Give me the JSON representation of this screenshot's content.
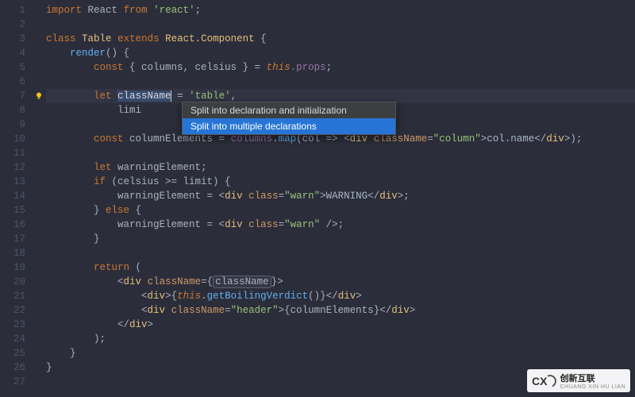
{
  "gutter": {
    "lines": [
      "1",
      "2",
      "3",
      "4",
      "5",
      "6",
      "7",
      "8",
      "9",
      "10",
      "11",
      "12",
      "13",
      "14",
      "15",
      "16",
      "17",
      "18",
      "19",
      "20",
      "21",
      "22",
      "23",
      "24",
      "25",
      "26",
      "27"
    ]
  },
  "code": {
    "l1": {
      "kw1": "import",
      "id": "React",
      "kw2": "from",
      "str": "'react'",
      "semi": ";"
    },
    "l3": {
      "kw": "class",
      "cls": "Table",
      "ext": "extends",
      "sup": "React.Component",
      "brace": " {"
    },
    "l4": {
      "fn": "render",
      "rest": "() {"
    },
    "l5": {
      "kw": "const",
      "rest": " { columns, celsius } = ",
      "this": "this",
      "prop": ".props",
      "semi": ";"
    },
    "l7": {
      "kw": "let",
      "name": "className",
      "op": " = ",
      "str": "'table'",
      "comma": ","
    },
    "l8": {
      "id": "limi"
    },
    "l10": {
      "kw": "const",
      "id": " columnElements = ",
      "obj": "columns",
      "dot": ".",
      "fn": "map",
      "open": "(",
      "param": "col",
      "arrow": " => ",
      "jsx_open": "<",
      "tag": "div",
      "sp": " ",
      "attr": "className",
      "eq": "=",
      "val": "\"column\"",
      "gt": ">",
      "expr": "col.name",
      "jsx_close": "</",
      "tag2": "div",
      "end": ">);"
    },
    "l12": {
      "kw": "let",
      "id": " warningElement;"
    },
    "l13": {
      "kw": "if",
      "cond": " (celsius >= limit) {"
    },
    "l14": {
      "lhs": "warningElement = ",
      "jsx_open": "<",
      "tag": "div",
      "sp": " ",
      "attr": "class",
      "eq": "=",
      "val": "\"warn\"",
      "gt": ">",
      "txt": "WARNING",
      "jsx_close": "</",
      "tag2": "div",
      "end": ">;"
    },
    "l15": {
      "brace": "} ",
      "kw": "else",
      "brace2": " {"
    },
    "l16": {
      "lhs": "warningElement = ",
      "jsx_open": "<",
      "tag": "div",
      "sp": " ",
      "attr": "class",
      "eq": "=",
      "val": "\"warn\"",
      "end": " />;"
    },
    "l17": {
      "brace": "}"
    },
    "l19": {
      "kw": "return",
      "rest": " ("
    },
    "l20": {
      "open": "<",
      "tag": "div",
      "sp": " ",
      "attr": "className",
      "eq": "=",
      "bo": "{",
      "expr": "className",
      "bc": "}",
      "gt": ">"
    },
    "l21": {
      "open": "<",
      "tag": "div",
      "gt": ">",
      "bo": "{",
      "this": "this",
      "dot": ".",
      "fn": "getBoilingVerdict",
      "call": "()",
      "bc": "}",
      "close": "</",
      "tag2": "div",
      "end": ">"
    },
    "l22": {
      "open": "<",
      "tag": "div",
      "sp": " ",
      "attr": "className",
      "eq": "=",
      "val": "\"header\"",
      "gt": ">",
      "bo": "{",
      "expr": "columnElements",
      "bc": "}",
      "close": "</",
      "tag2": "div",
      "end": ">"
    },
    "l23": {
      "close": "</",
      "tag": "div",
      "gt": ">"
    },
    "l24": {
      "p": ");"
    },
    "l25": {
      "b": "}"
    },
    "l26": {
      "b": "}"
    }
  },
  "popup": {
    "items": [
      "Split into declaration and initialization",
      "Split into multiple declarations"
    ]
  },
  "watermark": {
    "logo": "CX",
    "cn": "创新互联",
    "en": "CHUANG XIN HU LIAN"
  }
}
